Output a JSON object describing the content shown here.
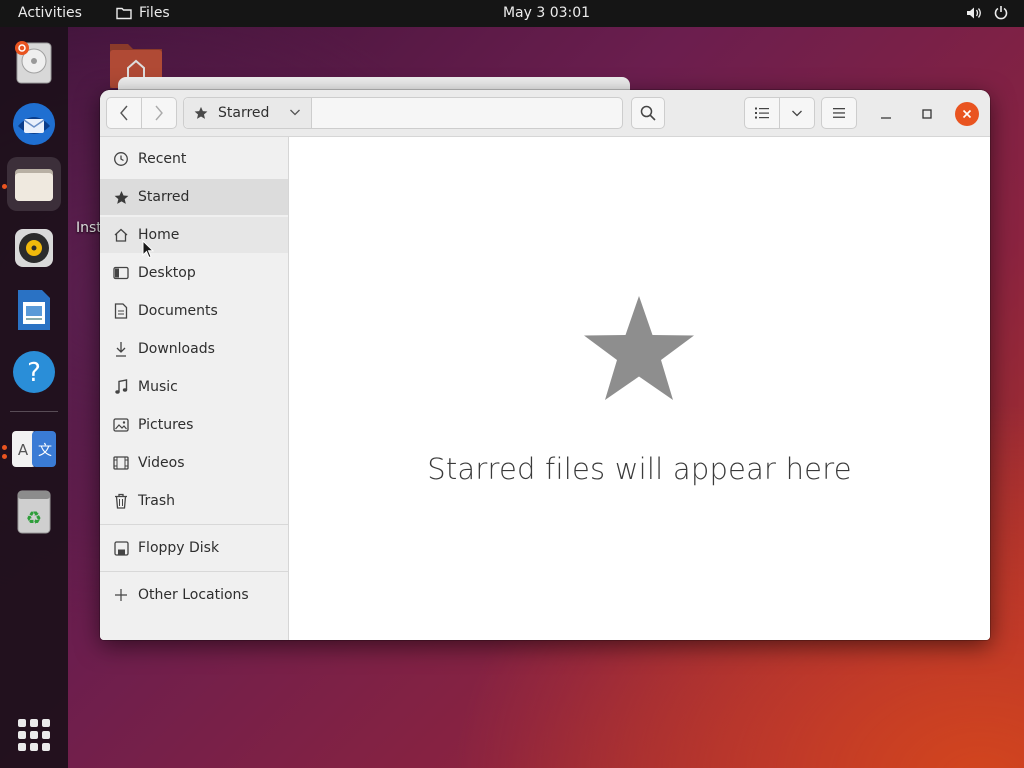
{
  "topbar": {
    "activities": "Activities",
    "app_name": "Files",
    "clock": "May 3  03:01"
  },
  "desktop": {
    "partial_label": "Inst"
  },
  "dock": {
    "items": [
      {
        "name": "ubuntu-installer",
        "icon": "disk-installer-icon"
      },
      {
        "name": "thunderbird",
        "icon": "thunderbird-icon"
      },
      {
        "name": "files",
        "icon": "files-icon",
        "active": true
      },
      {
        "name": "rhythmbox",
        "icon": "rhythmbox-icon"
      },
      {
        "name": "libreoffice-writer",
        "icon": "writer-icon"
      },
      {
        "name": "help",
        "icon": "help-icon"
      },
      {
        "name": "language-support",
        "icon": "language-icon"
      },
      {
        "name": "trash",
        "icon": "trash-icon"
      }
    ]
  },
  "window": {
    "path": {
      "current": "Starred",
      "icon": "star-icon"
    },
    "sidebar": {
      "items": [
        {
          "label": "Recent",
          "icon": "clock-icon"
        },
        {
          "label": "Starred",
          "icon": "star-icon",
          "selected": true
        },
        {
          "label": "Home",
          "icon": "home-icon",
          "hover": true
        },
        {
          "label": "Desktop",
          "icon": "desktop-icon"
        },
        {
          "label": "Documents",
          "icon": "document-icon"
        },
        {
          "label": "Downloads",
          "icon": "download-icon"
        },
        {
          "label": "Music",
          "icon": "music-icon"
        },
        {
          "label": "Pictures",
          "icon": "picture-icon"
        },
        {
          "label": "Videos",
          "icon": "video-icon"
        },
        {
          "label": "Trash",
          "icon": "trash-icon"
        }
      ],
      "devices": [
        {
          "label": "Floppy Disk",
          "icon": "floppy-icon"
        }
      ],
      "other": {
        "label": "Other Locations",
        "icon": "plus-icon"
      }
    },
    "empty_state": {
      "message": "Starred files will appear here",
      "icon": "star-icon"
    }
  },
  "colors": {
    "accent": "#e95420",
    "topbar": "#151515",
    "sidebar_bg": "#f0f0f0"
  }
}
